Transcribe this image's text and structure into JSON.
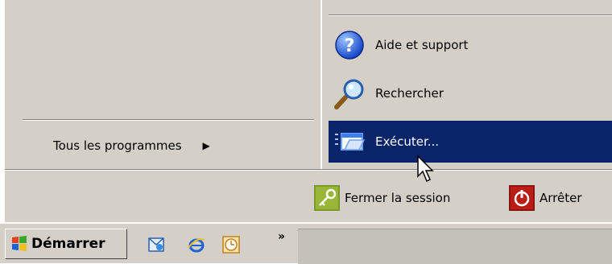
{
  "start_menu": {
    "all_programs_label": "Tous les programmes",
    "right_items": [
      {
        "label": "Aide et support",
        "icon": "help-icon"
      },
      {
        "label": "Rechercher",
        "icon": "search-icon"
      },
      {
        "label": "Exécuter...",
        "icon": "run-icon",
        "selected": true
      }
    ],
    "footer": {
      "logoff_label": "Fermer la session",
      "shutdown_label": "Arrêter"
    }
  },
  "taskbar": {
    "start_label": "Démarrer",
    "quick_launch": [
      "outlook-express-icon",
      "internet-explorer-icon",
      "clock-icon"
    ],
    "overflow_label": "»"
  },
  "colors": {
    "selection": "#0a246a",
    "menu_bg": "#d4d0c8"
  }
}
